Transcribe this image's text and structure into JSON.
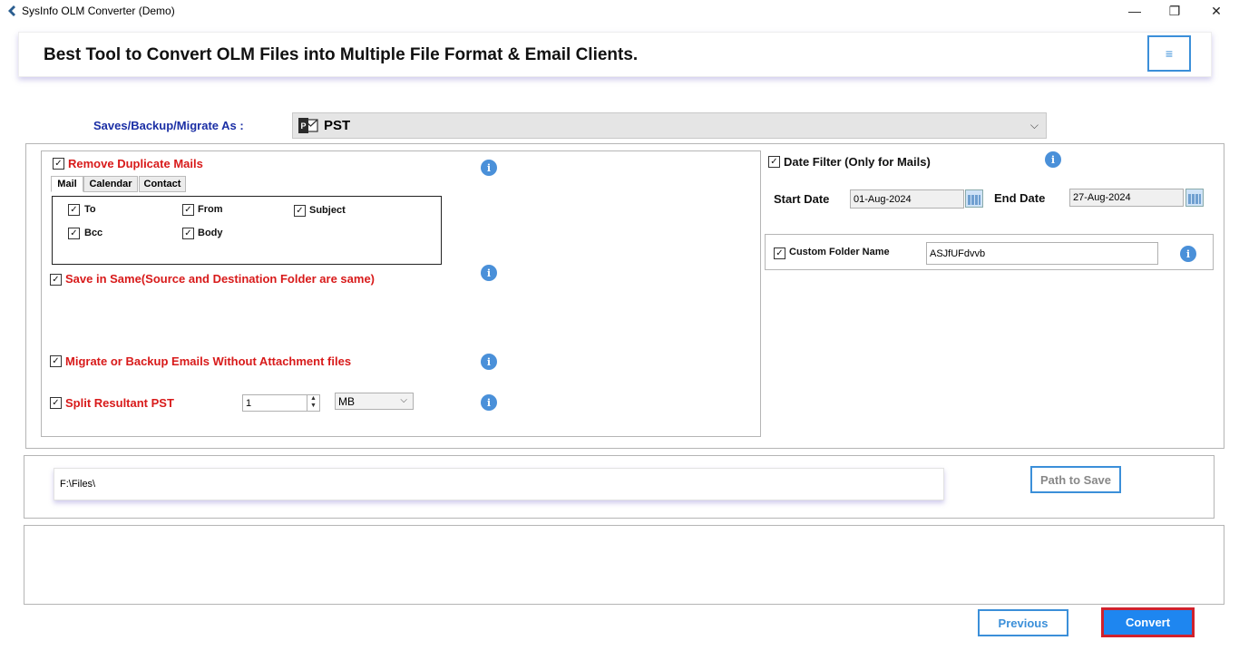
{
  "window": {
    "title": "SysInfo OLM Converter (Demo)",
    "minimize": "—",
    "maximize": "❐",
    "close": "✕"
  },
  "banner": {
    "text": "Best Tool to Convert OLM Files into Multiple File Format & Email Clients.",
    "menu_icon": "≡"
  },
  "saves": {
    "label": "Saves/Backup/Migrate As :",
    "selected": "PST",
    "chevron": "⌵"
  },
  "left_panel": {
    "remove_duplicates": {
      "label": "Remove Duplicate Mails",
      "checked": true
    },
    "tabs": [
      "Mail",
      "Calendar",
      "Contact"
    ],
    "active_tab": "Mail",
    "fields": [
      {
        "label": "To",
        "checked": true
      },
      {
        "label": "From",
        "checked": true
      },
      {
        "label": "Subject",
        "checked": true
      },
      {
        "label": "Bcc",
        "checked": true
      },
      {
        "label": "Body",
        "checked": true
      }
    ],
    "save_same": {
      "label": "Save in Same(Source and Destination Folder are same)",
      "checked": true
    },
    "without_attachments": {
      "label": "Migrate or Backup Emails Without Attachment files",
      "checked": true
    },
    "split": {
      "label": "Split Resultant PST",
      "checked": true,
      "value": "1",
      "unit": "MB"
    }
  },
  "right_panel": {
    "date_filter": {
      "label": "Date Filter  (Only for Mails)",
      "checked": true
    },
    "start_date_label": "Start Date",
    "start_date": "01-Aug-2024",
    "end_date_label": "End Date",
    "end_date": "27-Aug-2024",
    "custom_folder": {
      "label": "Custom Folder Name",
      "checked": true,
      "value": "ASJfUFdvvb"
    }
  },
  "path": {
    "value": "F:\\Files\\",
    "button": "Path to Save"
  },
  "footer": {
    "previous": "Previous",
    "convert": "Convert"
  },
  "info_glyph": "i",
  "check_glyph": "✓",
  "colors": {
    "accent_blue": "#3b8fd9",
    "label_red": "#d81a1a",
    "label_navy": "#1b2fa5",
    "convert_bg": "#1e86f0",
    "convert_border": "#d0222d"
  }
}
